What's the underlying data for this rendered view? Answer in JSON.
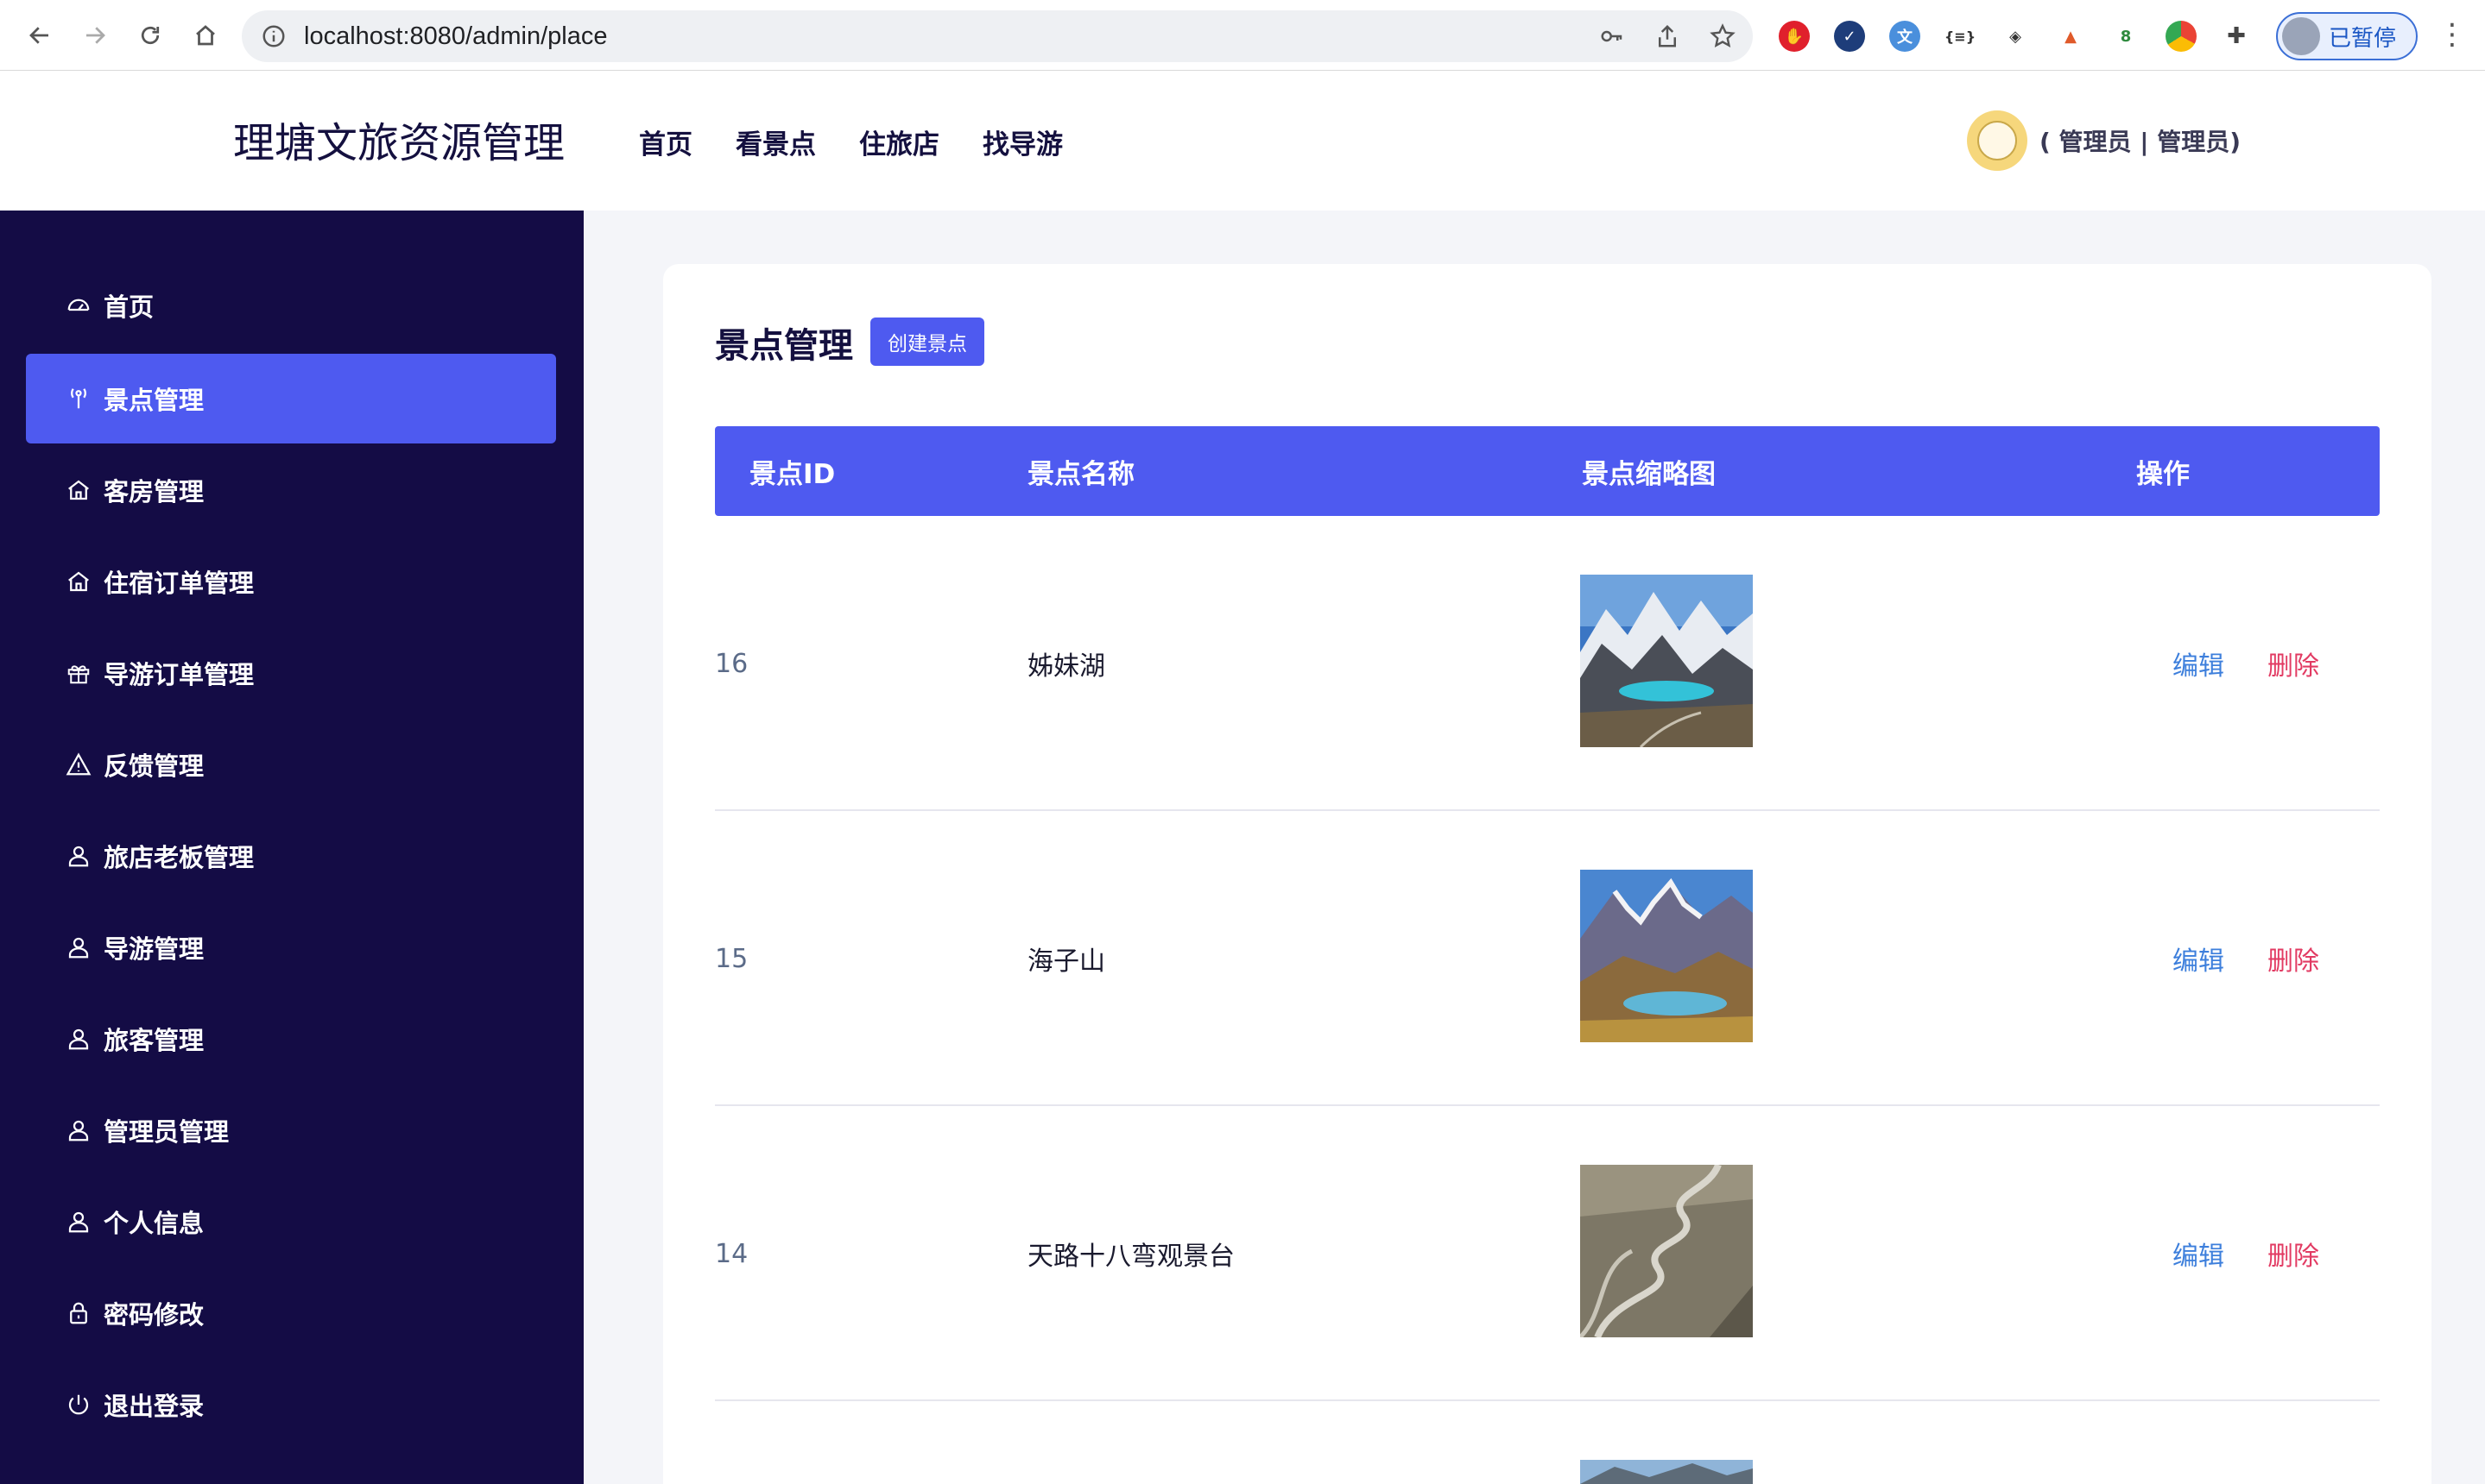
{
  "browser": {
    "url": "localhost:8080/admin/place",
    "profile_label": "已暂停"
  },
  "header": {
    "brand": "理塘文旅资源管理",
    "nav": [
      "首页",
      "看景点",
      "住旅店",
      "找导游"
    ],
    "user": "( 管理员 | 管理员)"
  },
  "sidebar": {
    "items": [
      {
        "label": "首页",
        "icon": "dashboard-icon"
      },
      {
        "label": "景点管理",
        "icon": "signal-tower-icon",
        "active": true
      },
      {
        "label": "客房管理",
        "icon": "home-icon"
      },
      {
        "label": "住宿订单管理",
        "icon": "home-icon"
      },
      {
        "label": "导游订单管理",
        "icon": "gift-icon"
      },
      {
        "label": "反馈管理",
        "icon": "warning-icon"
      },
      {
        "label": "旅店老板管理",
        "icon": "user-icon"
      },
      {
        "label": "导游管理",
        "icon": "user-icon"
      },
      {
        "label": "旅客管理",
        "icon": "user-icon"
      },
      {
        "label": "管理员管理",
        "icon": "user-icon"
      },
      {
        "label": "个人信息",
        "icon": "user-icon"
      },
      {
        "label": "密码修改",
        "icon": "lock-icon"
      },
      {
        "label": "退出登录",
        "icon": "power-icon"
      }
    ]
  },
  "main": {
    "title": "景点管理",
    "create_label": "创建景点",
    "columns": [
      "景点ID",
      "景点名称",
      "景点缩略图",
      "操作"
    ],
    "rows": [
      {
        "id": "16",
        "name": "姊妹湖",
        "edit": "编辑",
        "delete": "删除"
      },
      {
        "id": "15",
        "name": "海子山",
        "edit": "编辑",
        "delete": "删除"
      },
      {
        "id": "14",
        "name": "天路十八弯观景台",
        "edit": "编辑",
        "delete": "删除"
      }
    ]
  },
  "colors": {
    "sidebar_bg": "#140c45",
    "accent": "#4e5af0",
    "edit": "#3d7fdc",
    "delete": "#e23b63"
  }
}
